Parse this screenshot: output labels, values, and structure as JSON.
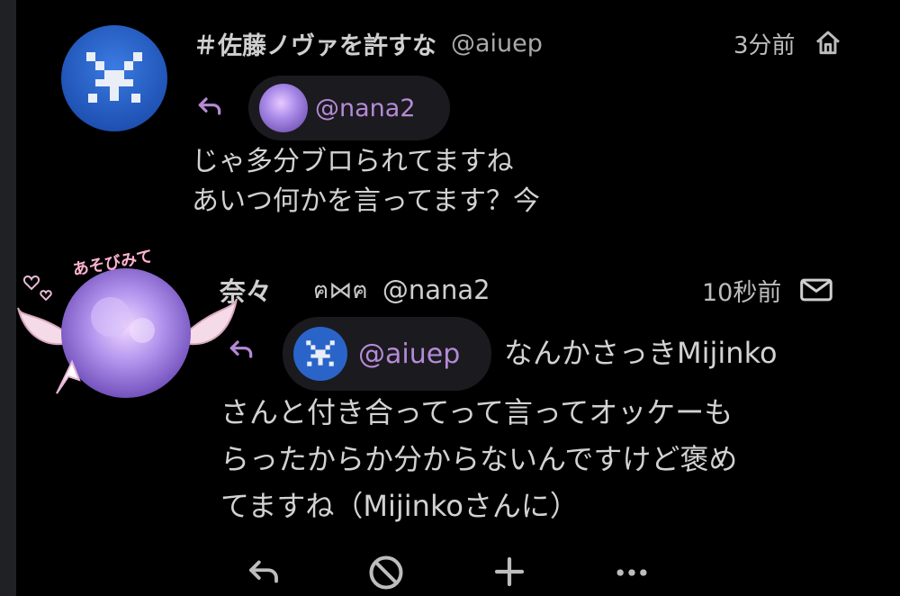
{
  "post": {
    "author_name": "＃佐藤ノヴァを許すな",
    "author_handle": "@aiuep",
    "time": "3分前",
    "visibility_icon": "home-icon",
    "reply_to_handle": "@nana2",
    "lines": [
      "じゃ多分ブロられてますね",
      "あいつ何かを言ってます？今"
    ]
  },
  "reply": {
    "author_name": "奈々",
    "author_emoji": "ฅ⋈ฅ",
    "author_handle": "@nana2",
    "time": "10秒前",
    "visibility_icon": "envelope-icon",
    "reply_to_handle": "@aiuep",
    "first_line_text": "なんかさっきMijinko",
    "lines": [
      "さんと付き合ってって言ってオッケーも",
      "らったからか分からないんですけど褒め",
      "てますね（Mijinkoさんに）"
    ]
  },
  "avatar_sticker_text": "あそびみて",
  "actions": [
    "reply-icon",
    "block-icon",
    "plus-icon",
    "more-icon"
  ],
  "colors": {
    "background": "#000000",
    "accent": "#b58ad6",
    "avatar_blue": "#2a64c8"
  }
}
